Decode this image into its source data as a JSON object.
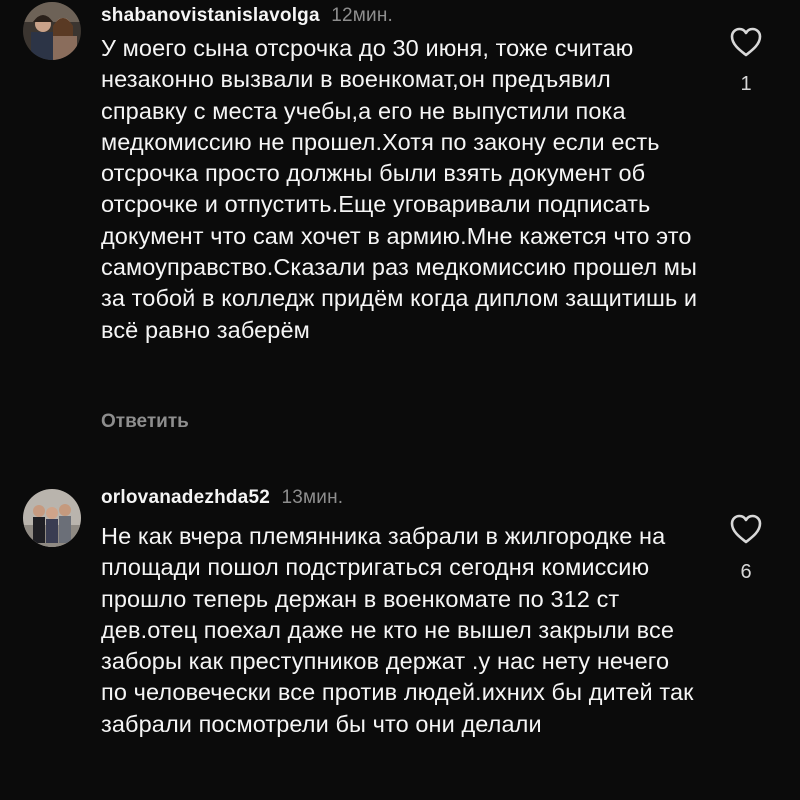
{
  "comments": [
    {
      "username": "shabanovistanislavolga",
      "time": "12мин.",
      "text": "У моего сына отсрочка до 30 июня, тоже считаю незаконно вызвали в военкомат,он предъявил справку с места учебы,а его не выпустили пока медкомиссию не прошел.Хотя по закону если есть отсрочка просто должны были взять документ об отсрочке и отпустить.Еще уговаривали подписать документ что сам хочет в армию.Мне кажется что это самоуправство.Сказали раз медкомиссию прошел мы за тобой в колледж придём когда диплом защитишь и всё равно заберём",
      "reply_label": "Ответить",
      "like_count": "1",
      "like_icon": "heart-outline-icon"
    },
    {
      "username": "orlovanadezhda52",
      "time": "13мин.",
      "text": "Не как вчера племянника забрали в жилгородке на площади пошол подстригаться сегодня комиссию прошло теперь держан в военкомате по 312 ст дев.отец поехал даже не кто не вышел закрыли все заборы как преступников держат .у нас нету нечего по человечески все против людей.ихних бы дитей так забрали посмотрели бы что они делали",
      "like_count": "6",
      "like_icon": "heart-outline-icon"
    }
  ]
}
